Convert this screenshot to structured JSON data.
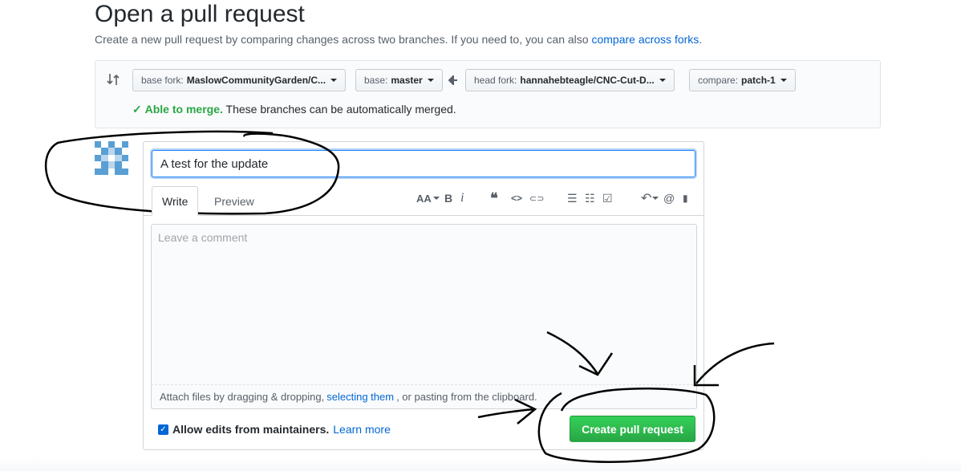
{
  "page": {
    "title": "Open a pull request",
    "subtitle_text": "Create a new pull request by comparing changes across two branches. If you need to, you can also",
    "subtitle_link": "compare across forks",
    "subtitle_end": "."
  },
  "range": {
    "base_fork_label": "base fork:",
    "base_fork_value": "MaslowCommunityGarden/C...",
    "base_label": "base:",
    "base_value": "master",
    "head_fork_label": "head fork:",
    "head_fork_value": "hannahebteagle/CNC-Cut-D...",
    "compare_label": "compare:",
    "compare_value": "patch-1",
    "merge_ok": "Able to merge.",
    "merge_text": "These branches can be automatically merged."
  },
  "composer": {
    "title_value": "A test for the update",
    "tabs": [
      "Write",
      "Preview"
    ],
    "toolbar": {
      "text_size": "AA",
      "bold": "B",
      "italic": "i",
      "quote": "❝",
      "code": "<>",
      "link": "⊂⊃",
      "ul": "☰",
      "ol": "☷",
      "tasks": "☑",
      "reply": "↶",
      "mention": "@",
      "bookmark": "▮"
    },
    "comment_placeholder": "Leave a comment",
    "attach_text_1": "Attach files by dragging & dropping,",
    "attach_link": "selecting them",
    "attach_text_2": ", or pasting from the clipboard.",
    "allow_edits_label": "Allow edits from maintainers.",
    "learn_more": "Learn more",
    "create_button": "Create pull request"
  },
  "colors": {
    "primary_green": "#28a745",
    "link_blue": "#0366d6",
    "annotation_ink": "#000000"
  }
}
